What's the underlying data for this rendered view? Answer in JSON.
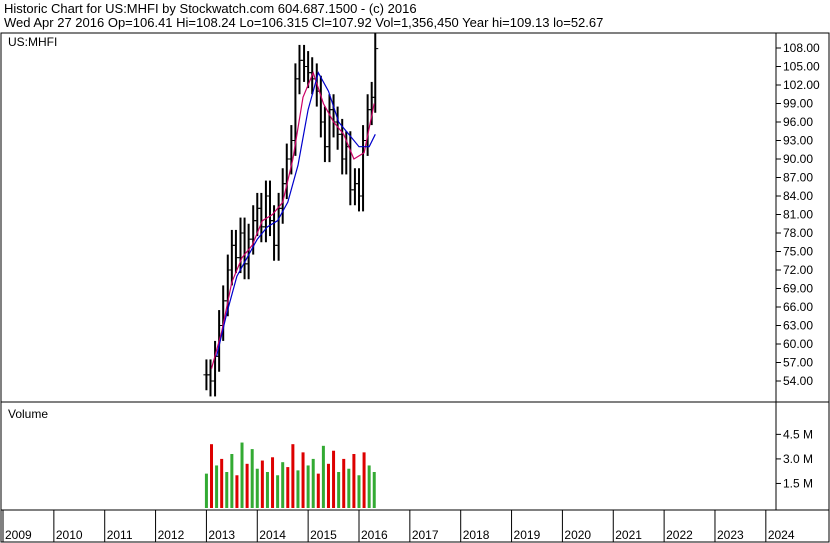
{
  "header": {
    "line1": "Historic Chart for US:MHFI by Stockwatch.com 604.687.1500 - (c) 2016",
    "line2": "Wed Apr 27 2016    Op=106.41    Hi=108.24    Lo=106.315    Cl=107.92    Vol=1,356,450    Year hi=109.13    lo=52.67"
  },
  "colors": {
    "price_bars": "#000000",
    "ma_short": "#cc0066",
    "ma_long": "#0000cc",
    "vol_up": "#33aa33",
    "vol_down": "#dd0000",
    "grid": "#000000"
  },
  "chart_data": [
    {
      "type": "line",
      "title": "US:MHFI",
      "ylim": [
        52,
        110
      ],
      "y_ticks": [
        "108.00",
        "105.00",
        "102.00",
        "99.00",
        "96.00",
        "93.00",
        "90.00",
        "87.00",
        "84.00",
        "81.00",
        "78.00",
        "75.00",
        "72.00",
        "69.00",
        "66.00",
        "63.00",
        "60.00",
        "57.00",
        "54.00"
      ],
      "x_ticks": [
        "2009",
        "2010",
        "2011",
        "2012",
        "2013",
        "2014",
        "2015",
        "2016",
        "2017",
        "2018",
        "2019",
        "2020",
        "2021",
        "2022",
        "2023",
        "2024"
      ],
      "xlim": [
        2009.0,
        2024.2
      ],
      "grid": false,
      "series": [
        {
          "style": "ohlc",
          "x": [
            2013.0,
            2013.08,
            2013.17,
            2013.25,
            2013.33,
            2013.42,
            2013.5,
            2013.58,
            2013.67,
            2013.75,
            2013.83,
            2013.92,
            2014.0,
            2014.08,
            2014.17,
            2014.25,
            2014.33,
            2014.42,
            2014.5,
            2014.58,
            2014.67,
            2014.75,
            2014.83,
            2014.92,
            2015.0,
            2015.08,
            2015.17,
            2015.25,
            2015.33,
            2015.42,
            2015.5,
            2015.58,
            2015.67,
            2015.75,
            2015.83,
            2015.92,
            2016.0,
            2016.08,
            2016.17,
            2016.25,
            2016.32
          ],
          "close": [
            55,
            54,
            58,
            63,
            67,
            72,
            76,
            74,
            78,
            73,
            77,
            80,
            82,
            79,
            84,
            80,
            76,
            82,
            86,
            90,
            93,
            103,
            106,
            105,
            104,
            103,
            101,
            96,
            92,
            98,
            96,
            94,
            90,
            92,
            85,
            86,
            84,
            93,
            98,
            100,
            107.9
          ]
        },
        {
          "name": "",
          "style": "ma",
          "x": [
            2013.1,
            2013.3,
            2013.5,
            2013.7,
            2013.9,
            2014.1,
            2014.3,
            2014.5,
            2014.7,
            2014.9,
            2015.1,
            2015.3,
            2015.5,
            2015.7,
            2015.9,
            2016.1,
            2016.3
          ],
          "values": [
            56,
            62,
            70,
            74,
            76,
            80,
            81,
            83,
            90,
            100,
            104,
            99,
            96,
            94,
            90,
            91,
            99
          ]
        },
        {
          "name": "",
          "style": "ma",
          "x": [
            2013.2,
            2013.4,
            2013.6,
            2013.8,
            2014.0,
            2014.2,
            2014.4,
            2014.6,
            2014.8,
            2015.0,
            2015.2,
            2015.4,
            2015.6,
            2015.8,
            2016.0,
            2016.2,
            2016.32
          ],
          "values": [
            58,
            65,
            71,
            74,
            77,
            79,
            80,
            83,
            89,
            98,
            104,
            101,
            96,
            94,
            92,
            92,
            94
          ]
        }
      ]
    },
    {
      "type": "bar",
      "title": "Volume",
      "ylim": [
        0,
        5.5
      ],
      "y_ticks": [
        "4.5 M",
        "3.0 M",
        "1.5 M"
      ],
      "y_tick_values": [
        4.5,
        3.0,
        1.5
      ],
      "x": [
        2013.0,
        2013.1,
        2013.2,
        2013.3,
        2013.4,
        2013.5,
        2013.6,
        2013.7,
        2013.8,
        2013.9,
        2014.0,
        2014.1,
        2014.2,
        2014.3,
        2014.4,
        2014.5,
        2014.6,
        2014.7,
        2014.8,
        2014.9,
        2015.0,
        2015.1,
        2015.2,
        2015.3,
        2015.4,
        2015.5,
        2015.6,
        2015.7,
        2015.8,
        2015.9,
        2016.0,
        2016.1,
        2016.2,
        2016.3
      ],
      "values": [
        2.1,
        3.9,
        2.6,
        3.0,
        2.2,
        3.3,
        2.0,
        4.0,
        2.7,
        3.6,
        2.4,
        2.9,
        2.2,
        3.1,
        2.0,
        2.8,
        2.5,
        3.9,
        2.3,
        3.4,
        2.6,
        3.0,
        2.1,
        3.8,
        2.7,
        3.5,
        2.2,
        3.0,
        2.4,
        3.3,
        2.0,
        3.4,
        2.6,
        2.2
      ],
      "up": [
        true,
        false,
        true,
        false,
        true,
        true,
        false,
        true,
        false,
        true,
        true,
        false,
        true,
        false,
        true,
        true,
        false,
        false,
        true,
        false,
        true,
        true,
        false,
        true,
        false,
        false,
        true,
        false,
        true,
        false,
        true,
        false,
        true,
        true
      ]
    }
  ]
}
